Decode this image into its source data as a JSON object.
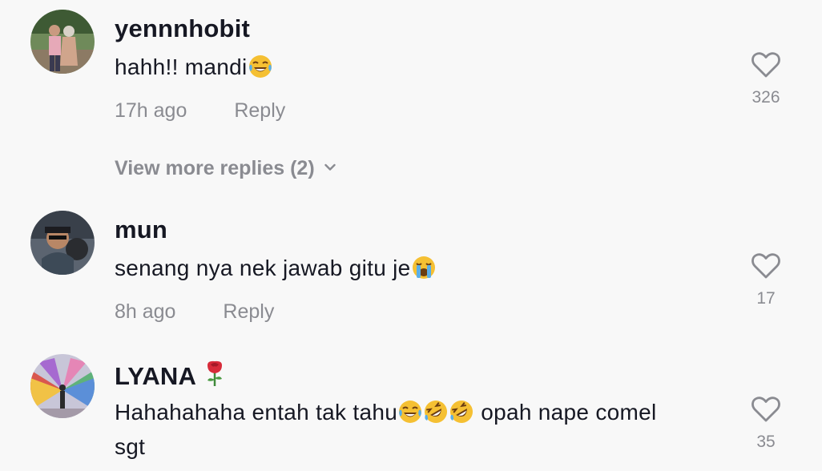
{
  "comments": [
    {
      "username": "yennnhobit",
      "text": "hahh!! mandi",
      "emojis": [
        "face-with-tears-of-joy"
      ],
      "time": "17h ago",
      "reply_label": "Reply",
      "likes": "326"
    },
    {
      "username": "mun",
      "text": "senang nya nek jawab gitu je",
      "emojis": [
        "loudly-crying-face"
      ],
      "time": "8h ago",
      "reply_label": "Reply",
      "likes": "17"
    },
    {
      "username": "LYANA",
      "username_emoji": "rose",
      "text_before": "Hahahahaha entah tak tahu",
      "emojis": [
        "face-with-tears-of-joy",
        "rolling-on-the-floor-laughing",
        "rolling-on-the-floor-laughing"
      ],
      "text_after": " opah nape comel",
      "text_line2": "sgt",
      "likes": "35"
    }
  ],
  "view_more": "View more replies (2)",
  "colors": {
    "background": "#f8f8f8",
    "primary_text": "#161823",
    "secondary_text": "#8a8b91"
  },
  "icons": {
    "like": "heart-outline-icon",
    "expand": "chevron-down-icon"
  }
}
